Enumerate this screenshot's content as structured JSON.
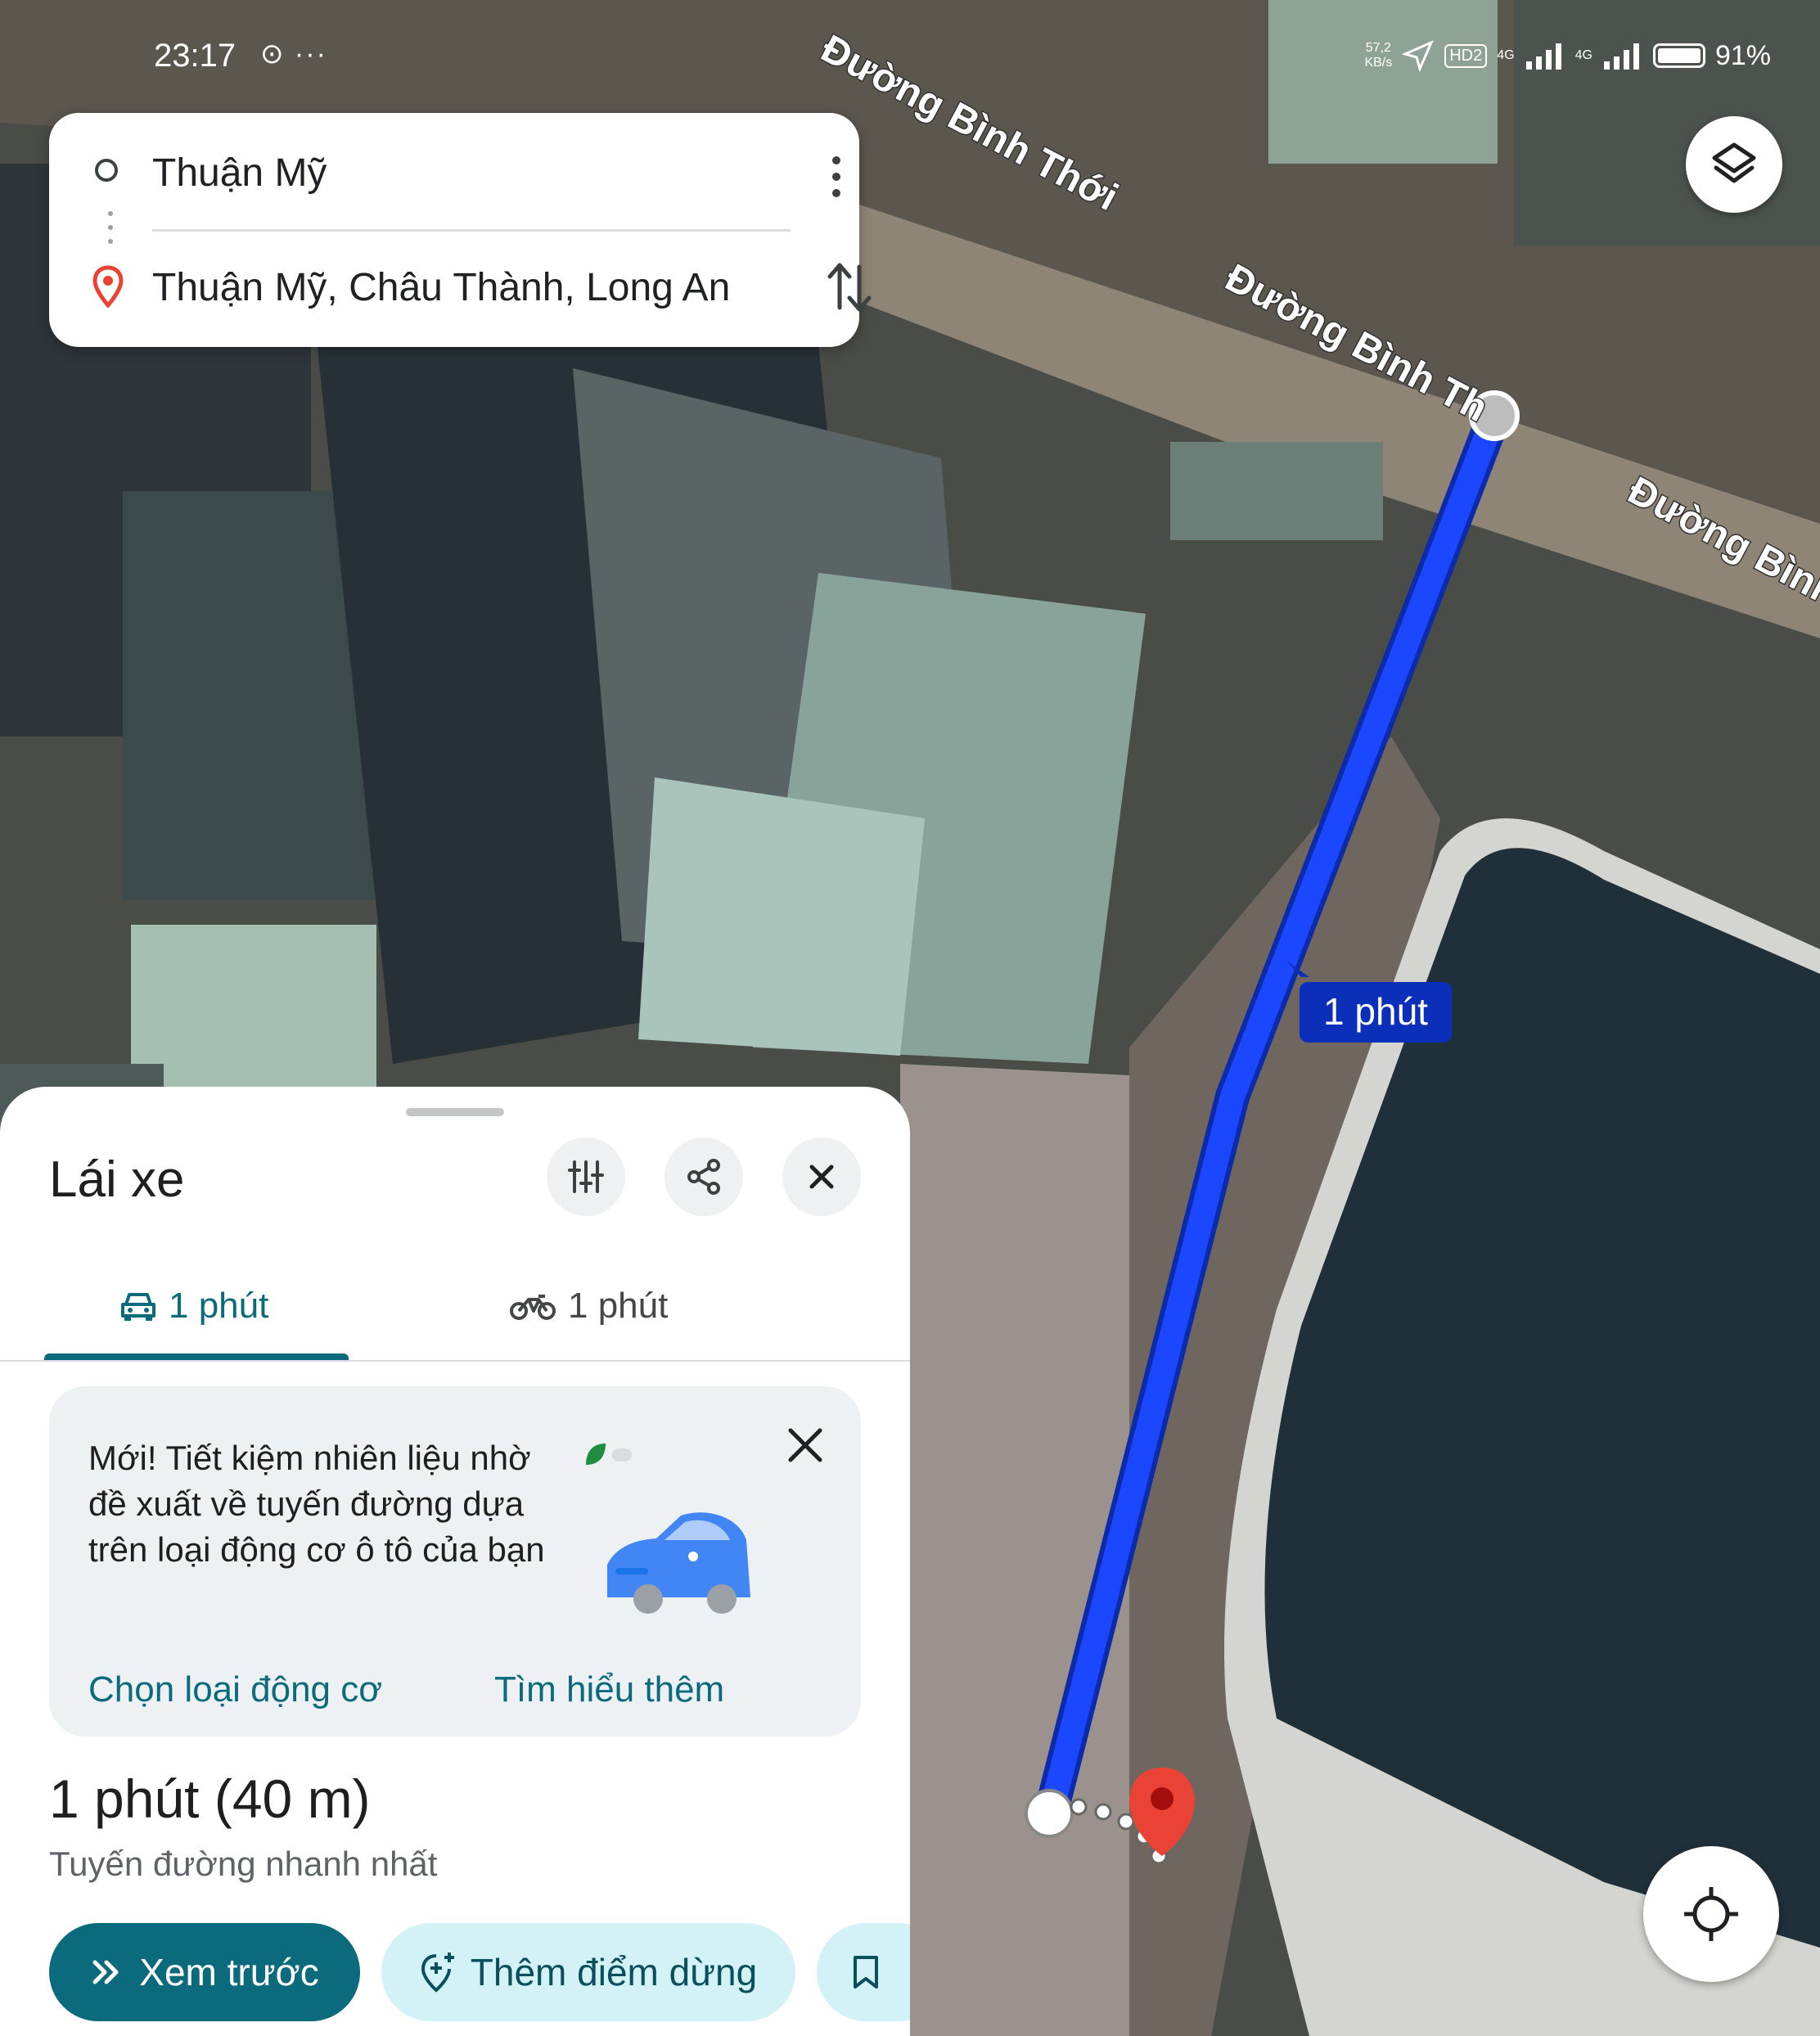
{
  "status_bar": {
    "time": "23:17",
    "left_icons": "⊙ ···",
    "net_speed_top": "57,2",
    "net_speed_bottom": "KB/s",
    "hd_badge": "HD2",
    "sig1_label": "4G",
    "sig2_label": "4G",
    "battery": "91%"
  },
  "search": {
    "origin": "Thuận Mỹ",
    "destination": "Thuận Mỹ, Châu Thành, Long An"
  },
  "map": {
    "road_labels": [
      "Đường Bình Thới",
      "Đường Bình Th",
      "Đường Bình"
    ],
    "route_time_label": "1 phút",
    "route_color": "#1a47ff",
    "destination_pin_color": "#ea4335"
  },
  "sheet": {
    "title": "Lái xe",
    "tabs": [
      {
        "icon": "car-icon",
        "label": "1 phút",
        "active": true
      },
      {
        "icon": "motorbike-icon",
        "label": "1 phút",
        "active": false
      }
    ],
    "promo": {
      "text": "Mới! Tiết kiệm nhiên liệu nhờ đề xuất về tuyến đường dựa trên loại động cơ ô tô của bạn",
      "link_choose": "Chọn loại động cơ",
      "link_learn": "Tìm hiểu thêm"
    },
    "route": {
      "time_distance": "1 phút (40 m)",
      "subtitle": "Tuyến đường nhanh nhất"
    },
    "actions": {
      "preview": "Xem trước",
      "add_stop": "Thêm điểm dừng"
    }
  },
  "colors": {
    "accent": "#0b6b7c",
    "accent_light": "#d3f2f7"
  }
}
